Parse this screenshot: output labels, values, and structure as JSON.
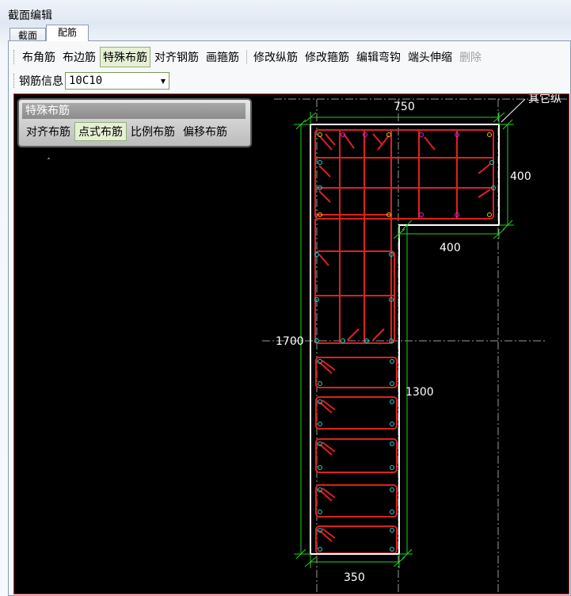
{
  "window": {
    "title": "截面编辑"
  },
  "tabs": [
    {
      "label": "截面"
    },
    {
      "label": "配筋"
    }
  ],
  "toolbar": {
    "buttons": [
      "布角筋",
      "布边筋",
      "特殊布筋",
      "对齐钢筋",
      "画箍筋",
      "修改纵筋",
      "修改箍筋",
      "编辑弯钩",
      "端头伸缩",
      "删除"
    ],
    "active": "特殊布筋",
    "disabled": "删除"
  },
  "rebar_info": {
    "label": "钢筋信息",
    "value": "10C10"
  },
  "special_panel": {
    "title": "特殊布筋",
    "buttons": [
      "对齐布筋",
      "点式布筋",
      "比例布筋",
      "偏移布筋"
    ],
    "active": "点式布筋"
  },
  "drawing": {
    "dims": {
      "top_width": "750",
      "right_height": "400",
      "step_width": "400",
      "total_height": "1700",
      "lower_height": "1300",
      "bottom_width": "350"
    },
    "corner_label": "其它纵",
    "colors": {
      "background": "#000000",
      "outline": "#ffffff",
      "rebar": "#e02020",
      "dimension": "#20d020",
      "axis": "#b0b0b0"
    }
  }
}
